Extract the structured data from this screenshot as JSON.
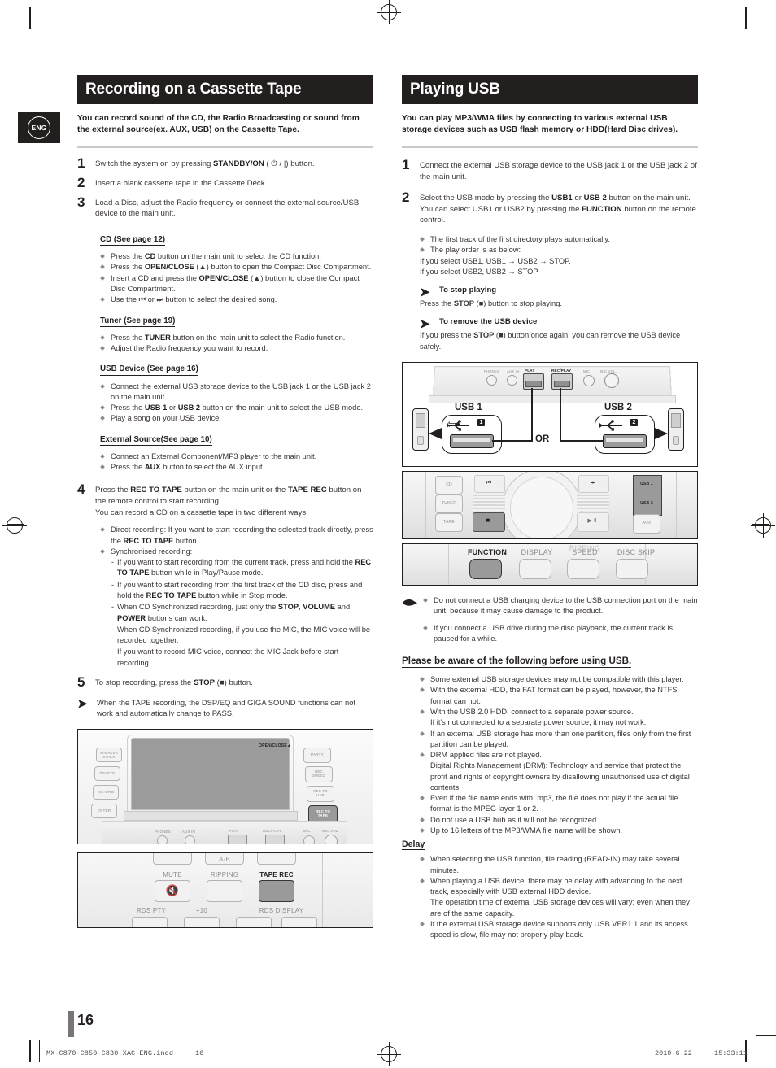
{
  "page": {
    "number": "16",
    "lang_badge": "ENG"
  },
  "footer": {
    "file": "MX-C870-C850-C830-XAC-ENG.indd",
    "page": "16",
    "date": "2010-6-22",
    "time": "15:33:11"
  },
  "left": {
    "banner_title": "Recording on a Cassette Tape",
    "intro": "You can record sound of the CD, the Radio Broadcasting or sound from the external source(ex. AUX, USB) on the Cassette Tape.",
    "steps": [
      {
        "num": "1",
        "text_html": "Switch the system on by pressing <b>STANDBY/ON</b> ( ⏻ / |) button."
      },
      {
        "num": "2",
        "text_html": "Insert a blank cassette tape in the Cassette Deck."
      },
      {
        "num": "3",
        "text_html": "Load a Disc, adjust the Radio frequency or connect the external source/USB device to the main unit."
      }
    ],
    "cd_head": "CD (See page 12)",
    "cd_bullets_html": [
      "Press the <b>CD</b> button on the main unit to select the CD function.",
      "Press the <b>OPEN/CLOSE</b> (▲) button to open the Compact Disc Compartment.",
      "Insert a CD and press the <b>OPEN/CLOSE</b> (▲) button to close the Compact Disc Compartment.",
      "Use the ⏮ or ⏭ button to select the desired song."
    ],
    "tuner_head": "Tuner (See page 19)",
    "tuner_bullets_html": [
      "Press the <b>TUNER</b> button on the main unit to select the Radio function.",
      "Adjust the Radio frequency you want to record."
    ],
    "usb_head": "USB Device (See page 16)",
    "usb_bullets_html": [
      "Connect the external USB storage device to the USB jack 1 or the USB jack 2 on the main unit.",
      "Press the <b>USB 1</b> or <b>USB 2</b> button on the main unit to select the USB mode.",
      "Play a song on your USB device."
    ],
    "ext_head": "External Source(See page 10)",
    "ext_bullets_html": [
      "Connect an External Component/MP3 player to the main unit.",
      "Press the <b>AUX</b> button to select the AUX input."
    ],
    "step4": {
      "num": "4",
      "text_html": "Press the <b>REC TO TAPE</b> button on the main unit or the <b>TAPE REC</b> button on the remote control to start recording.<br>You can record a CD on a cassette tape in two different ways."
    },
    "step4_bullets_html": [
      "Direct recording: If you want to start recording the selected track directly, press the <b>REC TO TAPE</b> button.",
      "Synchronised recording:"
    ],
    "step4_dashes_html": [
      "If you want to start recording from the current track, press and hold the <b>REC TO TAPE</b> button while in Play/Pause mode.",
      "If you want to start recording from the first track of the CD disc, press and hold the <b>REC TO TAPE</b> button while in Stop mode.",
      "When CD Synchronized recording, just only the <b>STOP</b>, <b>VOLUME</b> and <b>POWER</b> buttons can work.",
      "When CD Synchronized recording, if you use the MIC, the MIC voice will be recorded together.",
      "If you want to record MIC voice, connect the MIC Jack before start recording."
    ],
    "step5": {
      "num": "5",
      "text_html": "To stop recording, press the <b>STOP</b> (■) button."
    },
    "note_html": "When the TAPE recording, the DSP/EQ and GIGA SOUND functions can not work and automatically change to PASS.",
    "figure_main_unit": {
      "caption_openclose": "OPEN/CLOSE",
      "left_buttons": [
        "SPEAKER STACK",
        "DELETE",
        "RETURN",
        "ENTER"
      ],
      "right_buttons": [
        "PARTY",
        "REC SPEED",
        "REC TO USB",
        "REC TO TAPE"
      ],
      "highlighted": "REC TO TAPE",
      "bottom_labels": [
        "PHONES",
        "AUX IN",
        "PLAY",
        "REC/PLAY",
        "MIC",
        "MIC VOL."
      ]
    },
    "figure_remote": {
      "top_labels": [
        "A-B"
      ],
      "row_labels": [
        "MUTE",
        "RIPPING",
        "TAPE REC"
      ],
      "bottom_labels": [
        "RDS PTY",
        "+10",
        "RDS DISPLAY"
      ],
      "highlighted": "TAPE REC"
    }
  },
  "right": {
    "banner_title": "Playing USB",
    "intro": "You can play MP3/WMA files by connecting to various external USB storage devices such as USB flash memory or HDD(Hard Disc drives).",
    "steps": [
      {
        "num": "1",
        "text_html": "Connect the external USB storage device to the USB jack 1 or the USB jack 2 of the main unit."
      },
      {
        "num": "2",
        "text_html": "Select the USB mode by pressing the <b>USB1</b> or <b>USB 2</b> button on the main unit.<br>You can select USB1 or USB2 by pressing the <b>FUNCTION</b> button on the remote control."
      }
    ],
    "bullets_html": [
      "The first track of the first directory plays automatically.",
      "The play order is as below:"
    ],
    "play_order_lines": [
      "If you select USB1, USB1 → USB2 → STOP.",
      "If you select USB2, USB2 → STOP."
    ],
    "note_stop": {
      "title": "To stop playing",
      "body_html": "Press the <b>STOP</b> (■) button to stop playing."
    },
    "note_remove": {
      "title": "To remove the USB device",
      "body_html": "If you press the <b>STOP</b> (■) button once again, you can remove the USB device safely."
    },
    "figure_usb": {
      "usb1_label": "USB 1",
      "usb2_label": "USB 2",
      "or_label": "OR",
      "badge1": "1",
      "badge2": "2",
      "rear_labels": [
        "PHONES",
        "AUX IN",
        "PLAY",
        "REC/PLAY",
        "MIC",
        "MIC VOL."
      ],
      "play_label": "PLAY",
      "recplay_label": "REC/PLAY"
    },
    "figure_panel": {
      "left_buttons": [
        "CD",
        "TUNER",
        "TAPE"
      ],
      "right_buttons": [
        "USB 1",
        "USB 2",
        "AUX"
      ],
      "transport": [
        "⏮",
        "■",
        "⏭",
        "▶ Ⅱ"
      ],
      "highlighted": [
        "USB 1",
        "USB 2",
        "■"
      ]
    },
    "figure_function": {
      "labels": [
        "FUNCTION",
        "DISPLAY",
        "RIPPING",
        "SPEED",
        "DISC SKIP"
      ],
      "highlighted": "FUNCTION"
    },
    "hand_bullets_html": [
      "Do not connect a USB charging device to the USB connection port on the main unit, because it may cause damage to the product.",
      "If you connect a USB drive during the disc playback, the current track is paused for a while."
    ],
    "aware_head": "Please be aware of the following before using USB.",
    "aware_bullets_html": [
      "Some external USB storage devices may not be compatible with this player.",
      "With the external HDD, the FAT format can be played, however, the NTFS format can not.",
      "With the USB 2.0 HDD, connect to a separate power source.<br>If it's not connected to a separate power source, it may not work.",
      "If an external USB storage has more than one partition, files only from the first partition can be played.",
      "DRM applied files are not played.<br>Digital Rights Management (DRM): Technology and service that protect the profit and rights of copyright owners by disallowing unauthorised use of digital contents.",
      "Even if the file name ends with .mp3, the file does not play if the actual file format is the MPEG layer 1 or 2.",
      "Do not use a USB hub as it will not be recognized.",
      "Up to 16 letters of the MP3/WMA file name will be shown."
    ],
    "delay_head": "Delay",
    "delay_bullets_html": [
      "When selecting the USB function, file reading (READ-IN) may take several minutes.",
      "When playing a USB device, there may be delay with advancing to the next track, especially with USB external HDD device.<br>The operation time of external USB storage devices will vary; even when they are of the same capacity.",
      "If the external USB storage device supports only USB VER1.1 and its access speed is slow, file may not properly play back."
    ]
  }
}
